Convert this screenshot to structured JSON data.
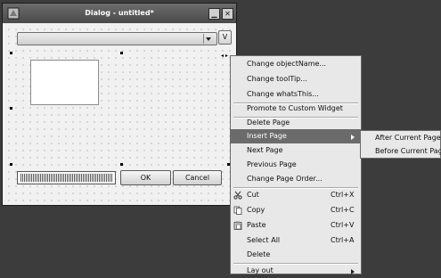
{
  "window": {
    "title": "Dialog - untitled*",
    "min_label": "▁",
    "close_label": "✕"
  },
  "form": {
    "v_button_label": "V",
    "ok_label": "OK",
    "cancel_label": "Cancel",
    "selection_arrows": "◂ ▸"
  },
  "context_menu": {
    "items": [
      {
        "label": "Change objectName..."
      },
      {
        "label": "Change toolTip..."
      },
      {
        "label": "Change whatsThis..."
      },
      {
        "label": "Promote to Custom Widget"
      },
      {
        "label": "Delete Page"
      },
      {
        "label": "Insert Page",
        "submenu": true,
        "active": true
      },
      {
        "label": "Next Page"
      },
      {
        "label": "Previous Page"
      },
      {
        "label": "Change Page Order..."
      },
      {
        "label": "Cut",
        "shortcut": "Ctrl+X",
        "icon": "scissors-icon"
      },
      {
        "label": "Copy",
        "shortcut": "Ctrl+C",
        "icon": "copy-icon"
      },
      {
        "label": "Paste",
        "shortcut": "Ctrl+V",
        "icon": "paste-icon"
      },
      {
        "label": "Select All",
        "shortcut": "Ctrl+A"
      },
      {
        "label": "Delete"
      },
      {
        "label": "Lay out",
        "submenu": true
      }
    ]
  },
  "insert_page_submenu": {
    "items": [
      {
        "label": "After Current Page"
      },
      {
        "label": "Before Current Page"
      }
    ]
  },
  "colors": {
    "desktop": "#3c3c3c",
    "menu_highlight": "#6b6b6b",
    "menu_background": "#e8e8e8"
  }
}
